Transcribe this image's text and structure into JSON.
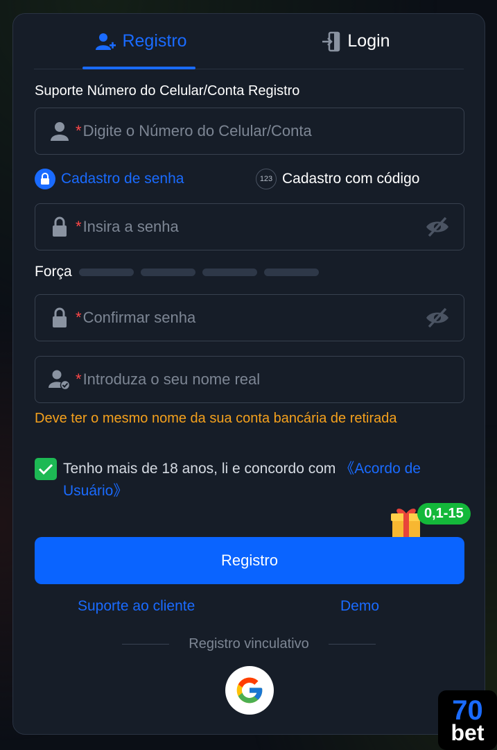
{
  "tabs": [
    {
      "label": "Registro",
      "icon": "user-plus-icon",
      "active": true
    },
    {
      "label": "Login",
      "icon": "login-door-icon",
      "active": false
    }
  ],
  "form": {
    "support_title": "Suporte Número do Celular/Conta Registro",
    "account": {
      "required": "*",
      "placeholder": "Digite o Número do Celular/Conta",
      "value": ""
    },
    "modes": [
      {
        "label": "Cadastro de senha",
        "icon": "lock-icon",
        "selected": true
      },
      {
        "label": "Cadastro com código",
        "icon": "123-icon",
        "badge_text": "123",
        "selected": false
      }
    ],
    "password": {
      "required": "*",
      "placeholder": "Insira a senha",
      "value": ""
    },
    "strength_label": "Força",
    "strength_level": 0,
    "confirm": {
      "required": "*",
      "placeholder": "Confirmar senha",
      "value": ""
    },
    "real_name": {
      "required": "*",
      "placeholder": "Introduza o seu nome real",
      "value": ""
    },
    "name_warning": "Deve ter o mesmo nome da sua conta bancária de retirada",
    "agree": {
      "checked": true,
      "text": "Tenho mais de 18 anos, li e concordo com ",
      "link": "《Acordo de Usuário》"
    },
    "bonus_badge": "0,1-15",
    "submit_label": "Registro"
  },
  "links": {
    "support": "Suporte ao cliente",
    "demo": "Demo"
  },
  "divider_text": "Registro vinculativo",
  "social": [
    {
      "icon": "google-icon"
    }
  ],
  "brand": {
    "line1": "70",
    "line2": "bet"
  },
  "colors": {
    "accent": "#1a6bff",
    "panel": "#161d28",
    "warning": "#f5a11d",
    "success": "#1db954",
    "required": "#ff4848"
  }
}
